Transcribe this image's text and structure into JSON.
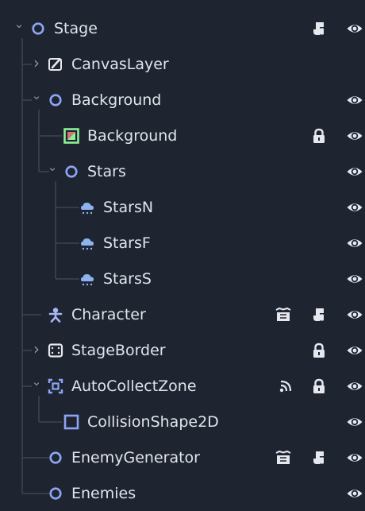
{
  "scene_tree": {
    "nodes": [
      {
        "label": "Stage",
        "icon": "node-icon",
        "badges": [
          "script-icon"
        ],
        "visible": true
      },
      {
        "label": "CanvasLayer",
        "icon": "canvas-layer-icon",
        "badges": [],
        "visible": false
      },
      {
        "label": "Background",
        "icon": "node-icon",
        "badges": [],
        "visible": true
      },
      {
        "label": "Background",
        "icon": "color-rect-icon",
        "badges": [
          "lock-icon"
        ],
        "visible": true
      },
      {
        "label": "Stars",
        "icon": "node-icon",
        "badges": [],
        "visible": true
      },
      {
        "label": "StarsN",
        "icon": "particles-icon",
        "badges": [],
        "visible": true
      },
      {
        "label": "StarsF",
        "icon": "particles-icon",
        "badges": [],
        "visible": true
      },
      {
        "label": "StarsS",
        "icon": "particles-icon",
        "badges": [],
        "visible": true
      },
      {
        "label": "Character",
        "icon": "character-icon",
        "badges": [
          "scene-instance-icon",
          "script-icon"
        ],
        "visible": true
      },
      {
        "label": "StageBorder",
        "icon": "control-icon",
        "badges": [
          "lock-icon"
        ],
        "visible": true
      },
      {
        "label": "AutoCollectZone",
        "icon": "area2d-icon",
        "badges": [
          "signal-icon",
          "lock-icon"
        ],
        "visible": true
      },
      {
        "label": "CollisionShape2D",
        "icon": "collision-shape-icon",
        "badges": [],
        "visible": true
      },
      {
        "label": "EnemyGenerator",
        "icon": "node-icon",
        "badges": [
          "scene-instance-icon",
          "script-icon"
        ],
        "visible": true
      },
      {
        "label": "Enemies",
        "icon": "node-icon",
        "badges": [],
        "visible": true
      }
    ]
  },
  "colors": {
    "background": "#1f2431",
    "node_blue": "#8da5f3",
    "guide": "#3d4454",
    "text": "#e1e4ea",
    "icon_light": "#e6e8ee",
    "particles_blue": "#8eb4f0",
    "character_purple": "#a5b6f3",
    "rect_green": "#8eef97",
    "rect_red": "#e26d7a"
  }
}
